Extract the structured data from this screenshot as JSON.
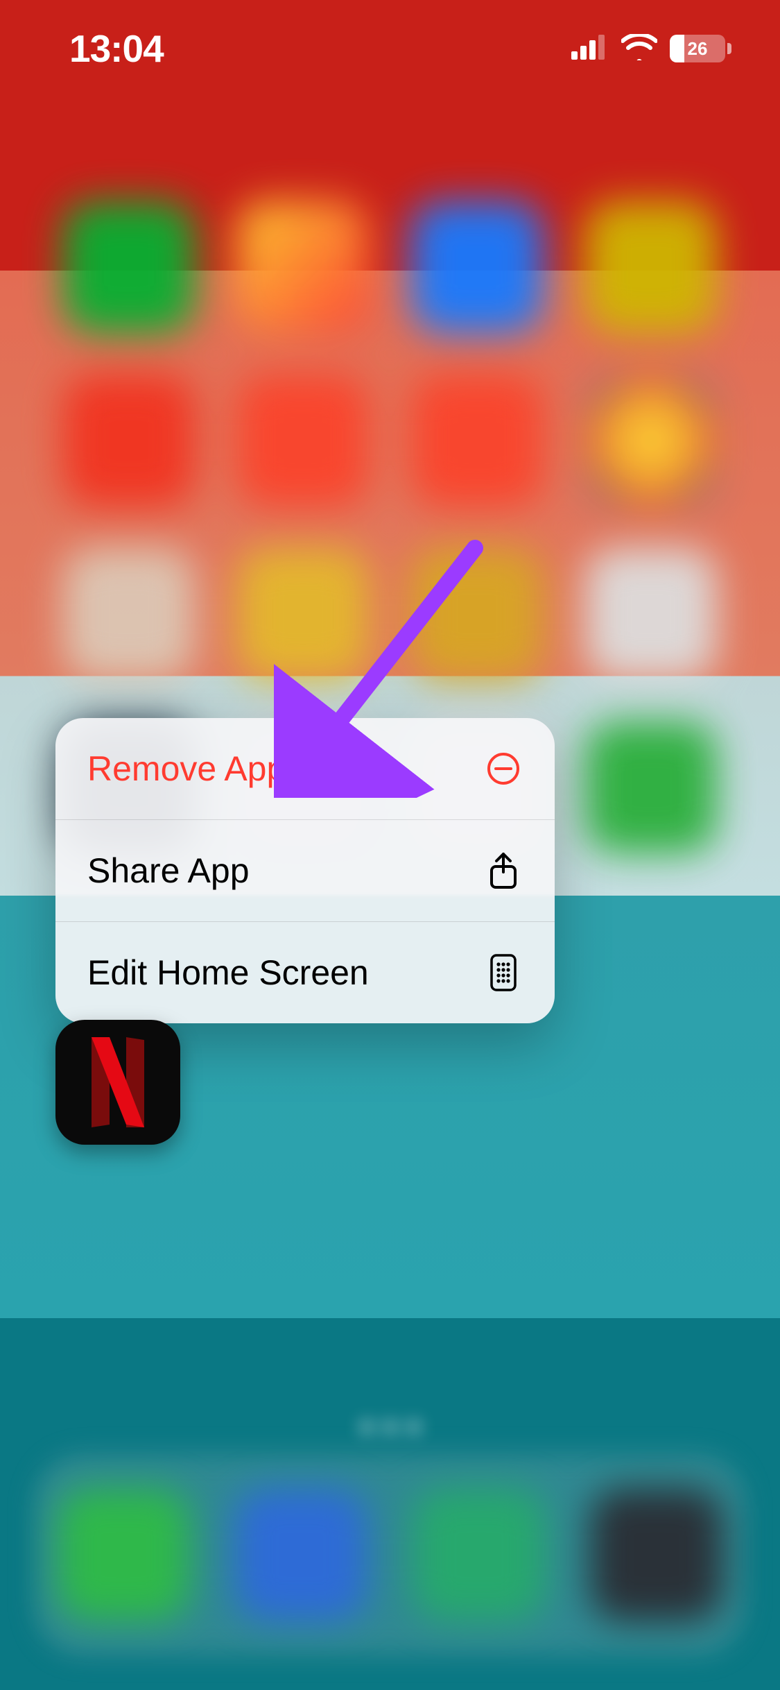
{
  "status": {
    "time": "13:04",
    "battery_pct": "26"
  },
  "menu": {
    "remove_label": "Remove App",
    "share_label": "Share App",
    "edit_label": "Edit Home Screen"
  },
  "app": {
    "name": "Netflix",
    "letter": "N"
  },
  "colors": {
    "destructive": "#ff3b30",
    "annotation": "#9b3bff"
  }
}
